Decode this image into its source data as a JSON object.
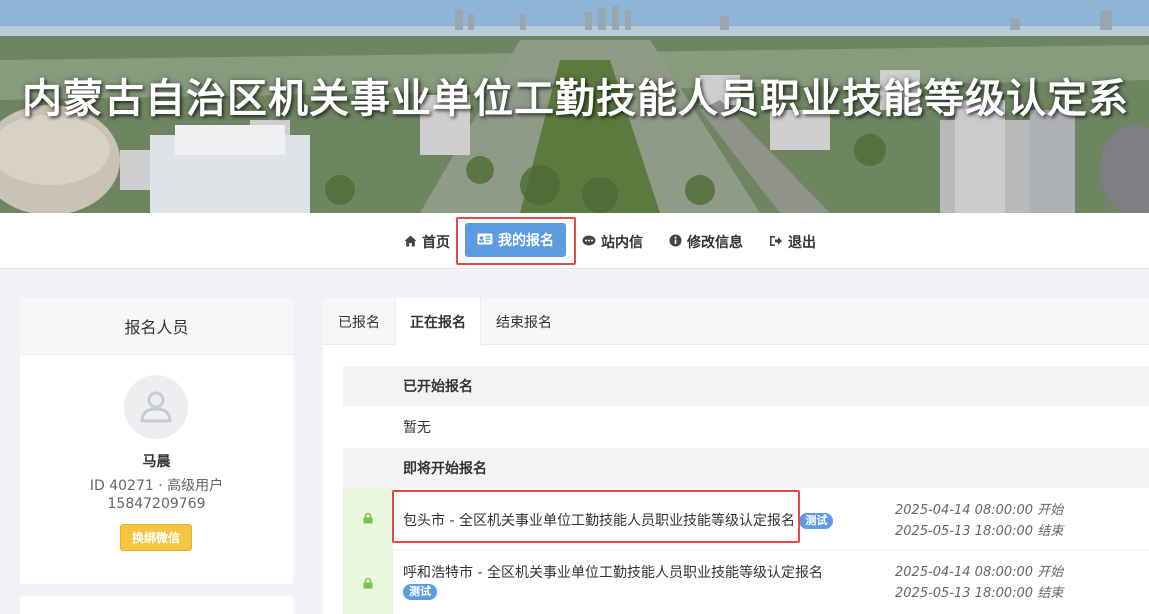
{
  "banner": {
    "title": "内蒙古自治区机关事业单位工勤技能人员职业技能等级认定系"
  },
  "nav": {
    "items": [
      {
        "icon": "home-icon",
        "label": "首页"
      },
      {
        "icon": "id-card-icon",
        "label": "我的报名"
      },
      {
        "icon": "chat-icon",
        "label": "站内信"
      },
      {
        "icon": "info-icon",
        "label": "修改信息"
      },
      {
        "icon": "sign-out-icon",
        "label": "退出"
      }
    ],
    "active": "我的报名"
  },
  "user_card": {
    "header": "报名人员",
    "name": "马晨",
    "id_line": "ID 40271 · 高级用户",
    "phone": "15847209769",
    "wechat_button": "换绑微信"
  },
  "tabs": [
    {
      "label": "已报名"
    },
    {
      "label": "正在报名"
    },
    {
      "label": "结束报名"
    }
  ],
  "sections": {
    "started": {
      "title": "已开始报名",
      "empty_text": "暂无"
    },
    "upcoming": {
      "title": "即将开始报名",
      "items": [
        {
          "title": "包头市 - 全区机关事业单位工勤技能人员职业技能等级认定报名",
          "badge": "测试",
          "start": "2025-04-14 08:00:00 开始",
          "end": "2025-05-13 18:00:00 结束"
        },
        {
          "title": "呼和浩特市 - 全区机关事业单位工勤技能人员职业技能等级认定报名",
          "badge": "测试",
          "start": "2025-04-14 08:00:00 开始",
          "end": "2025-05-13 18:00:00 结束"
        }
      ]
    }
  },
  "colors": {
    "accent": "#5b9be0",
    "highlight": "#e04a4a",
    "wechat_button": "#f5c542",
    "lock_cell": "#eaf7df",
    "lock_icon": "#7cbf4a"
  }
}
